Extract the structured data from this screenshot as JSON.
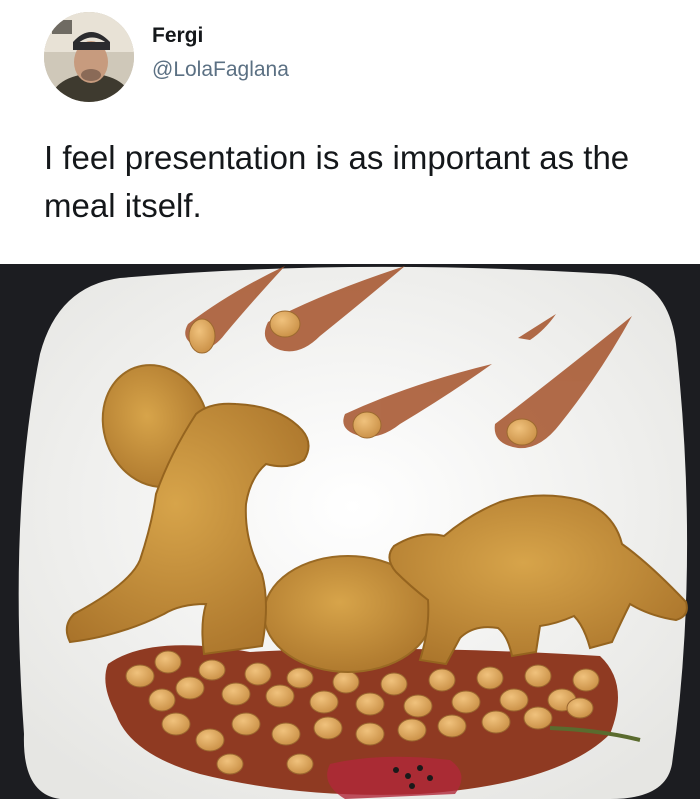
{
  "tweet": {
    "author_name": "Fergi",
    "author_handle": "@LolaFaglana",
    "text": "I feel presentation is as important as the meal itself."
  },
  "photo": {
    "subject": "food-plate-photo"
  },
  "colors": {
    "text_primary": "#14171a",
    "text_secondary": "#5b7083",
    "nugget": "#c08a32",
    "sauce": "#a5522a",
    "bean": "#d9a25a",
    "plate": "#f3f3f1"
  }
}
